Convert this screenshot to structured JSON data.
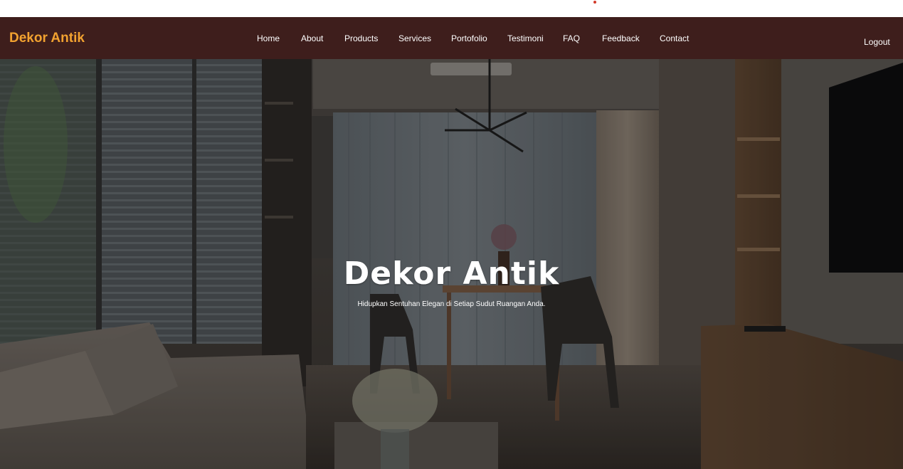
{
  "navbar": {
    "brand": "Dekor Antik",
    "links": [
      {
        "label": "Home"
      },
      {
        "label": "About"
      },
      {
        "label": "Products"
      },
      {
        "label": "Services"
      },
      {
        "label": "Portofolio"
      },
      {
        "label": "Testimoni"
      },
      {
        "label": "FAQ"
      },
      {
        "label": "Feedback"
      },
      {
        "label": "Contact"
      }
    ],
    "logout_label": "Logout"
  },
  "hero": {
    "title": "Dekor Antik",
    "subtitle": "Hidupkan Sentuhan Elegan di Setiap Sudut Ruangan Anda.",
    "background_image": "living-room-interior"
  },
  "colors": {
    "navbar_bg": "#3e1e1c",
    "brand": "#f2a230",
    "text": "#ffffff"
  }
}
